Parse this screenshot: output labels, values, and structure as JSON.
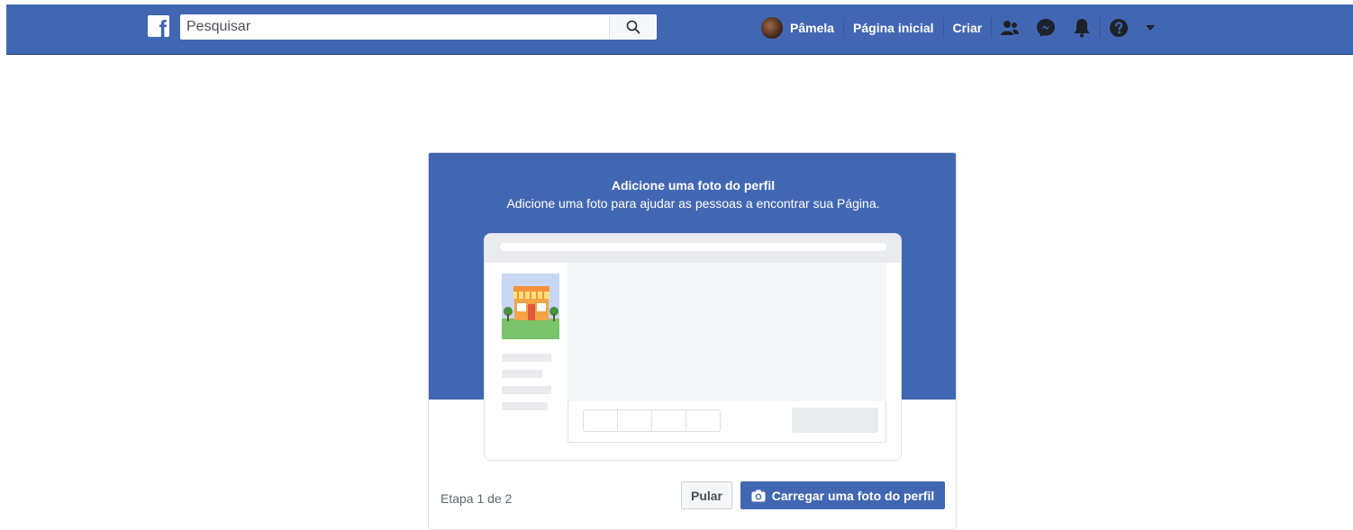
{
  "header": {
    "logo_icon": "facebook-f-icon",
    "search": {
      "placeholder": "Pesquisar",
      "value": ""
    },
    "user": {
      "name": "Pâmela"
    },
    "links": {
      "home": "Página inicial",
      "create": "Criar"
    },
    "icons": [
      "friends-icon",
      "messenger-icon",
      "notifications-bell-icon",
      "help-question-icon",
      "dropdown-arrow-icon"
    ],
    "colors": {
      "bar": "#4267b2",
      "text": "#ffffff"
    }
  },
  "dialog": {
    "title": "Adicione uma foto do perfil",
    "subtitle": "Adicione uma foto para ajudar as pessoas a encontrar sua Página.",
    "illustration": "page-preview-illustration",
    "step": "Etapa 1 de 2",
    "skip_label": "Pular",
    "upload_label": "Carregar uma foto do perfil",
    "upload_icon": "camera-icon",
    "colors": {
      "header": "#4267b2",
      "primary_button": "#4267b2"
    }
  }
}
